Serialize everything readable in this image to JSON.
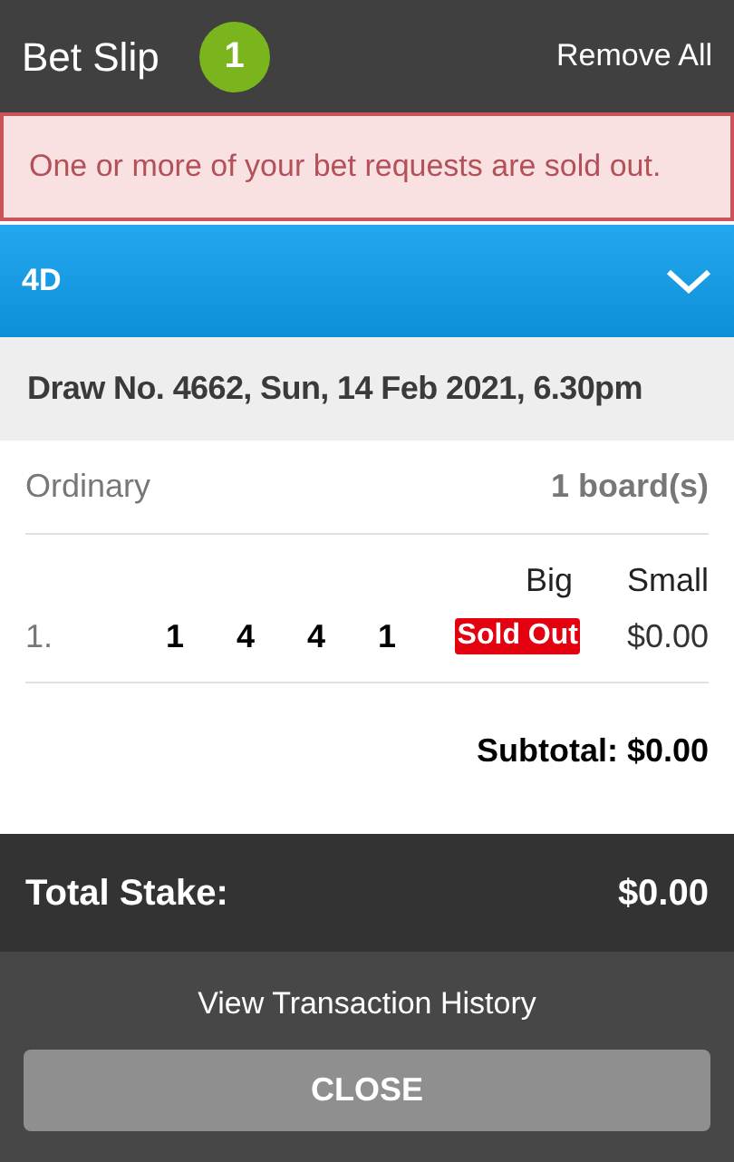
{
  "header": {
    "title": "Bet Slip",
    "count": "1",
    "remove_all": "Remove All"
  },
  "alert": {
    "message": "One or more of your bet requests are sold out."
  },
  "section": {
    "title": "4D",
    "expanded": true,
    "draw": "Draw No. 4662, Sun, 14 Feb 2021, 6.30pm",
    "bet_type": "Ordinary",
    "boards": "1 board(s)",
    "columns": [
      "Big",
      "Small"
    ],
    "rows": [
      {
        "index": "1.",
        "digits": [
          "1",
          "4",
          "4",
          "1"
        ],
        "big": {
          "text": "Sold Out",
          "sold_out": true
        },
        "small": {
          "text": "$0.00",
          "sold_out": false
        }
      }
    ],
    "subtotal": "Subtotal: $0.00"
  },
  "total": {
    "label": "Total Stake:",
    "value": "$0.00"
  },
  "footer": {
    "history_link": "View Transaction History",
    "close_button": "CLOSE"
  }
}
